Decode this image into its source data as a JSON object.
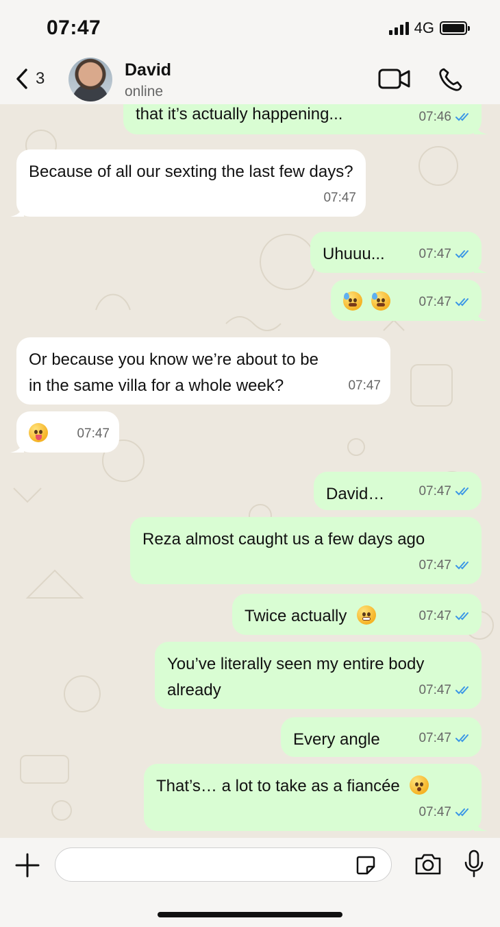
{
  "status_bar": {
    "time": "07:47",
    "network": "4G"
  },
  "header": {
    "back_count": "3",
    "contact_name": "David",
    "contact_status": "online"
  },
  "messages": [
    {
      "dir": "out",
      "text": "that it’s actually happening...",
      "time": "07:46",
      "read": true
    },
    {
      "dir": "in",
      "text": "Because of all our sexting the last few days?",
      "time": "07:47"
    },
    {
      "dir": "out",
      "text": "Uhuuu...",
      "time": "07:47",
      "read": true
    },
    {
      "dir": "out",
      "text": "",
      "emoji": [
        "hot-face-sweat",
        "hot-face-sweat"
      ],
      "time": "07:47",
      "read": true
    },
    {
      "dir": "in",
      "text": "Or because you know we’re about to be in the same villa for a whole week?",
      "time": "07:47"
    },
    {
      "dir": "in",
      "text": "",
      "emoji": [
        "zany-face"
      ],
      "time": "07:47"
    },
    {
      "dir": "out",
      "text": "David…",
      "time": "07:47",
      "read": true
    },
    {
      "dir": "out",
      "text": "Reza almost caught us a few days ago",
      "time": "07:47",
      "read": true
    },
    {
      "dir": "out",
      "text": "Twice actually",
      "emoji": [
        "grimacing-face"
      ],
      "time": "07:47",
      "read": true
    },
    {
      "dir": "out",
      "text": "You’ve literally seen my entire body already",
      "time": "07:47",
      "read": true
    },
    {
      "dir": "out",
      "text": "Every angle",
      "time": "07:47",
      "read": true
    },
    {
      "dir": "out",
      "text": "That’s… a lot to take as a fiancée",
      "emoji": [
        "flushed-face"
      ],
      "time": "07:47",
      "read": true
    }
  ],
  "input": {
    "value": "",
    "placeholder": ""
  },
  "colors": {
    "outgoing_bubble": "#d9fdd3",
    "incoming_bubble": "#ffffff",
    "read_ticks": "#3b96e6",
    "chat_background": "#ede8df"
  }
}
